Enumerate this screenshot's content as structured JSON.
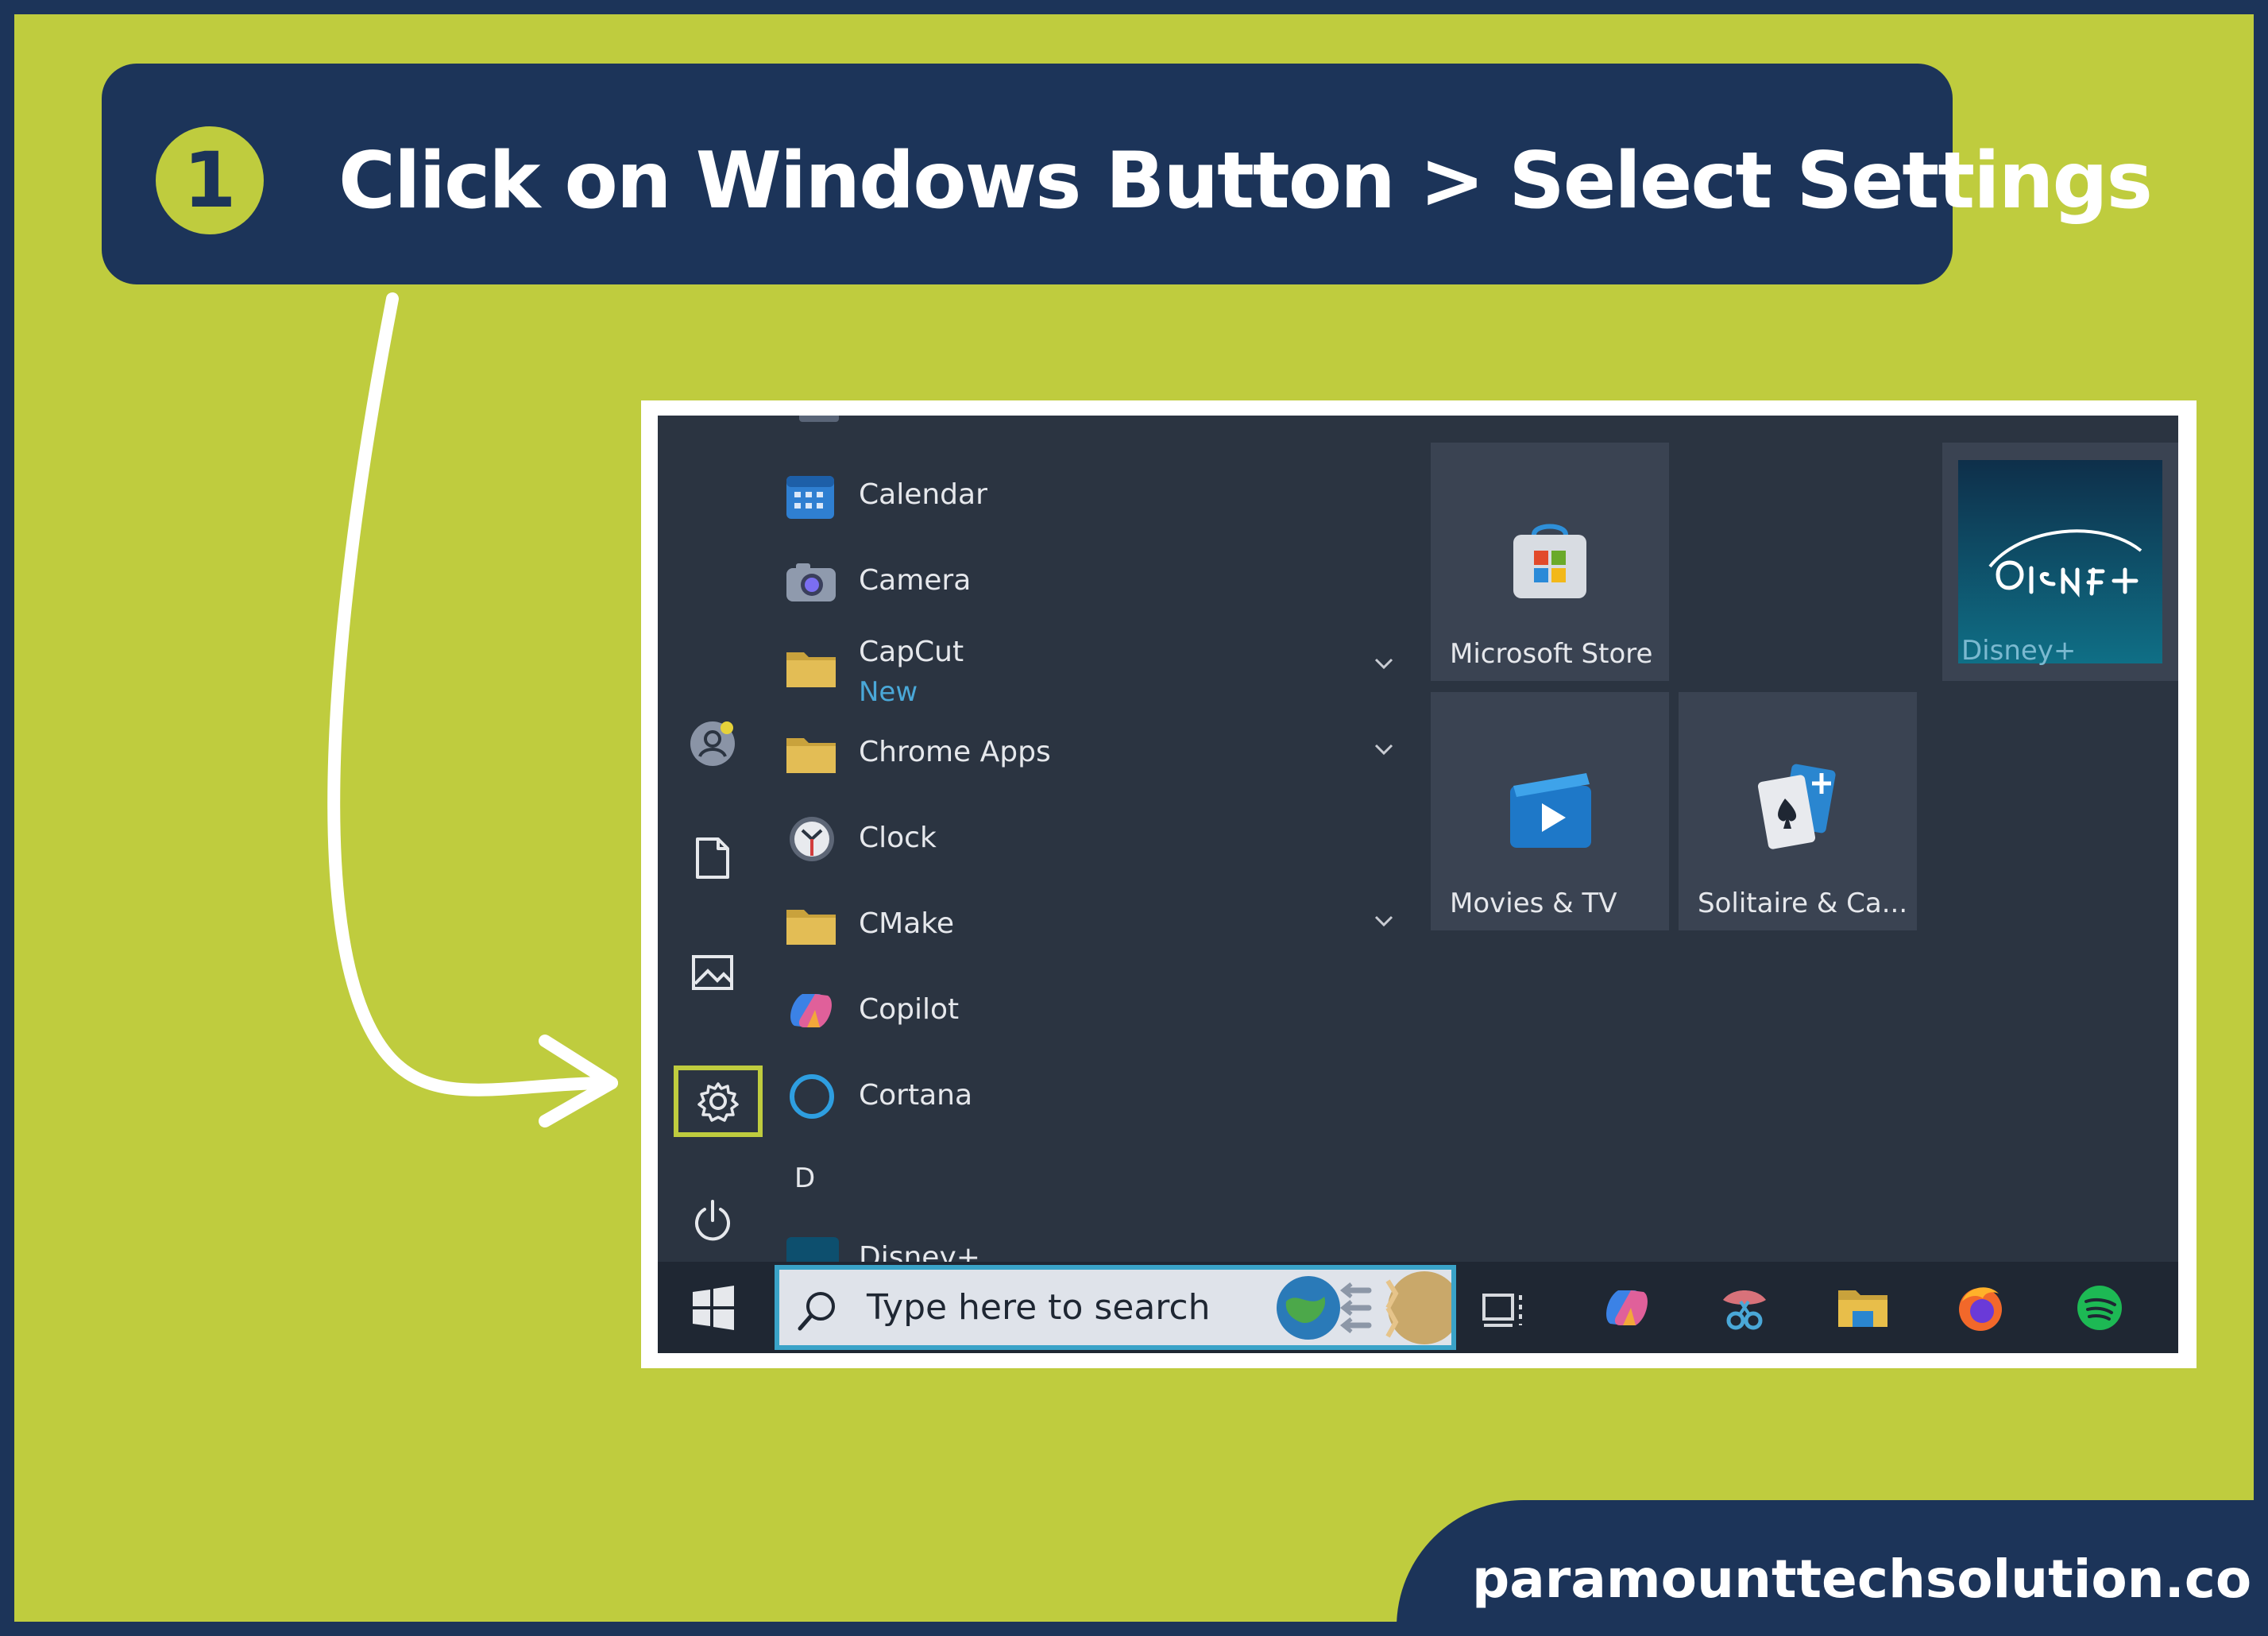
{
  "header": {
    "step_number": "1",
    "title": "Click on Windows Button > Select Settings"
  },
  "start_menu": {
    "apps": [
      {
        "name": "Calendar",
        "icon": "calendar-icon"
      },
      {
        "name": "Camera",
        "icon": "camera-icon"
      },
      {
        "name": "CapCut",
        "sub": "New",
        "icon": "folder-icon",
        "expandable": true
      },
      {
        "name": "Chrome Apps",
        "icon": "folder-icon",
        "expandable": true
      },
      {
        "name": "Clock",
        "icon": "clock-icon"
      },
      {
        "name": "CMake",
        "icon": "folder-icon",
        "expandable": true
      },
      {
        "name": "Copilot",
        "icon": "copilot-icon"
      },
      {
        "name": "Cortana",
        "icon": "cortana-icon"
      }
    ],
    "section_letter": "D",
    "partial_app": "Disney+",
    "tiles": [
      {
        "label": "Microsoft Store",
        "icon": "store-icon"
      },
      {
        "label": "Disney+",
        "icon": "disney-plus-icon"
      },
      {
        "label": "Movies & TV",
        "icon": "movies-tv-icon"
      },
      {
        "label": "Solitaire & Ca...",
        "icon": "solitaire-icon"
      }
    ],
    "rail_icons": [
      "user-icon",
      "document-icon",
      "pictures-icon",
      "settings-icon",
      "power-icon"
    ]
  },
  "taskbar": {
    "search_placeholder": "Type here to search",
    "icons": [
      "windows-icon",
      "search-icon",
      "task-view-icon",
      "copilot-icon",
      "snipping-tool-icon",
      "file-explorer-icon",
      "firefox-icon",
      "spotify-icon"
    ]
  },
  "colors": {
    "navy": "#1c3459",
    "lime": "#bfcc3e",
    "menu_bg": "#2b3441",
    "accent_blue": "#4aa8d8"
  },
  "footer": {
    "website": "paramounttechsolution.com"
  }
}
